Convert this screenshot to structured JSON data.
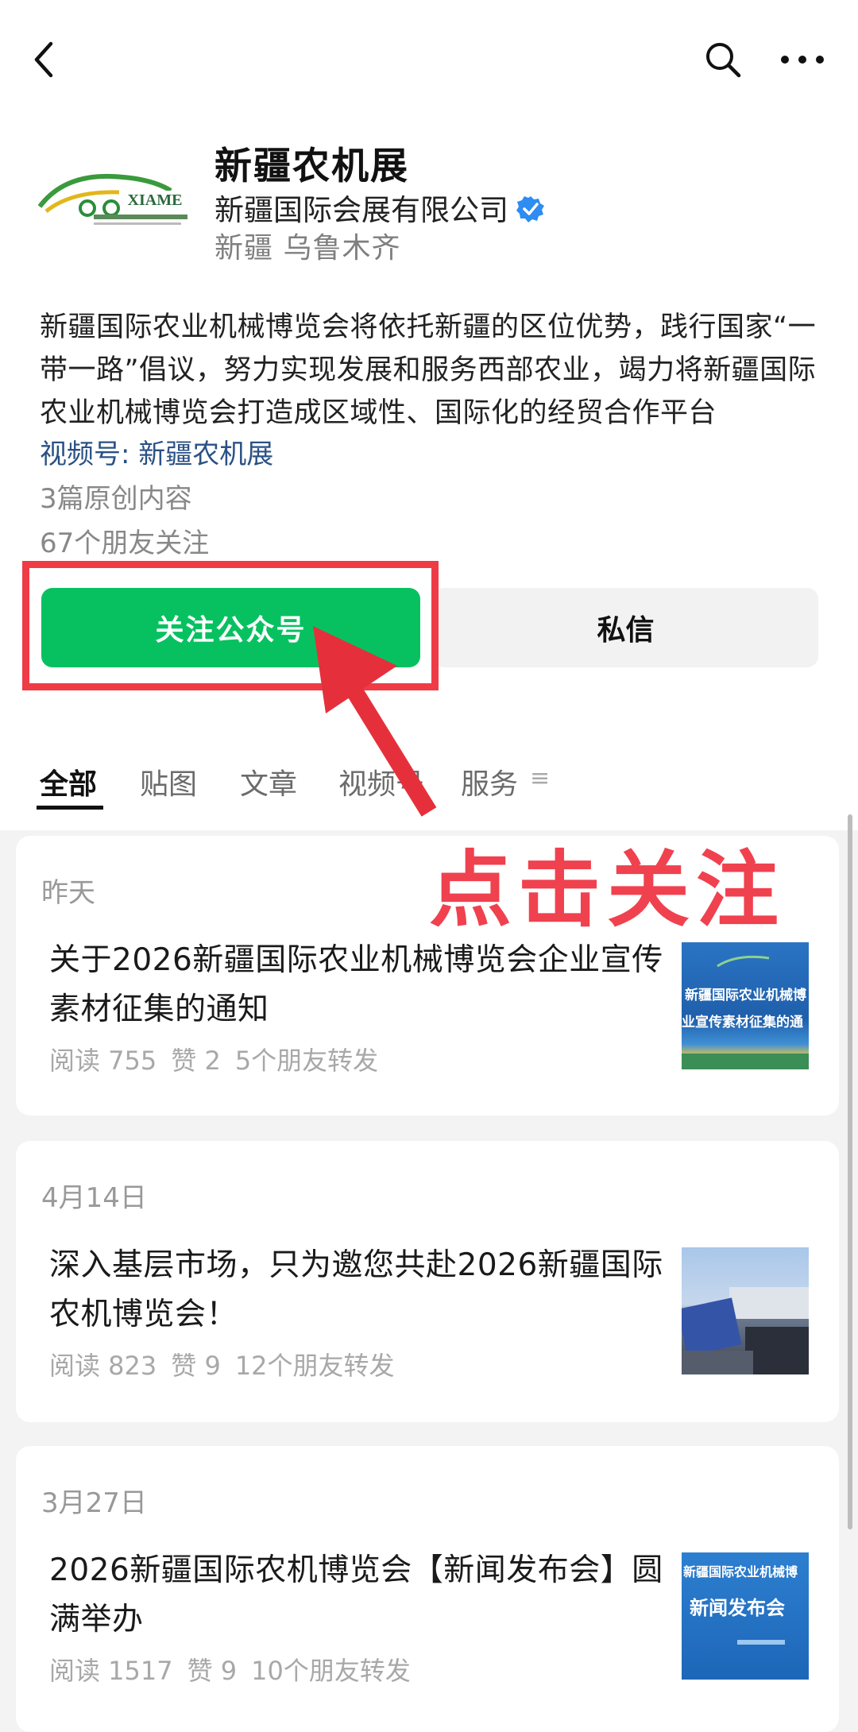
{
  "nav": {
    "back_icon": "back-arrow-icon",
    "search_icon": "search-icon",
    "more_icon": "more-dots-icon"
  },
  "account": {
    "logo_text": "XIAME",
    "name": "新疆农机展",
    "company": "新疆国际会展有限公司",
    "location": "新疆 乌鲁木齐",
    "description": "新疆国际农业机械博览会将依托新疆的区位优势，践行国家“一带一路”倡议，努力实现发展和服务西部农业，竭力将新疆国际农业机械博览会打造成区域性、国际化的经贸合作平台",
    "channel": "视频号: 新疆农机展",
    "original_count": "3篇原创内容",
    "friends_following": "67个朋友关注"
  },
  "buttons": {
    "follow": "关注公众号",
    "message": "私信"
  },
  "tabs": [
    {
      "label": "全部",
      "active": true
    },
    {
      "label": "贴图",
      "active": false
    },
    {
      "label": "文章",
      "active": false
    },
    {
      "label": "视频号",
      "active": false
    },
    {
      "label": "服务",
      "active": false
    }
  ],
  "tab_menu_icon": "≡",
  "annotation": {
    "text": "点击关注",
    "color": "#f0414f"
  },
  "articles": [
    {
      "date": "昨天",
      "title": "关于2026新疆国际农业机械博览会企业宣传素材征集的通知",
      "reads": "阅读 755",
      "likes": "赞 2",
      "shares": "5个朋友转发",
      "thumb_lines": [
        "新疆国际农业机械博",
        "业宣传素材征集的通"
      ]
    },
    {
      "date": "4月14日",
      "title": "深入基层市场，只为邀您共赴2026新疆国际农机博览会！",
      "reads": "阅读 823",
      "likes": "赞 9",
      "shares": "12个朋友转发",
      "thumb_lines": []
    },
    {
      "date": "3月27日",
      "title": "2026新疆国际农机博览会【新闻发布会】圆满举办",
      "reads": "阅读 1517",
      "likes": "赞 9",
      "shares": "10个朋友转发",
      "thumb_lines": [
        "新疆国际农业机械博",
        "新闻发布会"
      ]
    }
  ],
  "colors": {
    "primary_green": "#07c160",
    "link_blue": "#2a5185",
    "highlight_red": "#ee3b46"
  }
}
